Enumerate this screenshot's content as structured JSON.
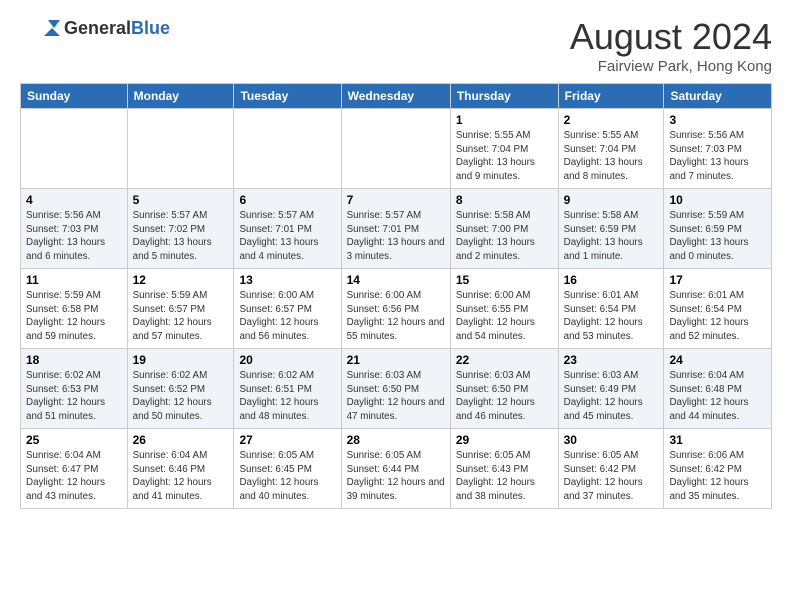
{
  "header": {
    "logo_general": "General",
    "logo_blue": "Blue",
    "month_title": "August 2024",
    "location": "Fairview Park, Hong Kong"
  },
  "days_of_week": [
    "Sunday",
    "Monday",
    "Tuesday",
    "Wednesday",
    "Thursday",
    "Friday",
    "Saturday"
  ],
  "weeks": [
    [
      {
        "num": "",
        "sunrise": "",
        "sunset": "",
        "daylight": ""
      },
      {
        "num": "",
        "sunrise": "",
        "sunset": "",
        "daylight": ""
      },
      {
        "num": "",
        "sunrise": "",
        "sunset": "",
        "daylight": ""
      },
      {
        "num": "",
        "sunrise": "",
        "sunset": "",
        "daylight": ""
      },
      {
        "num": "1",
        "sunrise": "5:55 AM",
        "sunset": "7:04 PM",
        "daylight": "13 hours and 9 minutes."
      },
      {
        "num": "2",
        "sunrise": "5:55 AM",
        "sunset": "7:04 PM",
        "daylight": "13 hours and 8 minutes."
      },
      {
        "num": "3",
        "sunrise": "5:56 AM",
        "sunset": "7:03 PM",
        "daylight": "13 hours and 7 minutes."
      }
    ],
    [
      {
        "num": "4",
        "sunrise": "5:56 AM",
        "sunset": "7:03 PM",
        "daylight": "13 hours and 6 minutes."
      },
      {
        "num": "5",
        "sunrise": "5:57 AM",
        "sunset": "7:02 PM",
        "daylight": "13 hours and 5 minutes."
      },
      {
        "num": "6",
        "sunrise": "5:57 AM",
        "sunset": "7:01 PM",
        "daylight": "13 hours and 4 minutes."
      },
      {
        "num": "7",
        "sunrise": "5:57 AM",
        "sunset": "7:01 PM",
        "daylight": "13 hours and 3 minutes."
      },
      {
        "num": "8",
        "sunrise": "5:58 AM",
        "sunset": "7:00 PM",
        "daylight": "13 hours and 2 minutes."
      },
      {
        "num": "9",
        "sunrise": "5:58 AM",
        "sunset": "6:59 PM",
        "daylight": "13 hours and 1 minute."
      },
      {
        "num": "10",
        "sunrise": "5:59 AM",
        "sunset": "6:59 PM",
        "daylight": "13 hours and 0 minutes."
      }
    ],
    [
      {
        "num": "11",
        "sunrise": "5:59 AM",
        "sunset": "6:58 PM",
        "daylight": "12 hours and 59 minutes."
      },
      {
        "num": "12",
        "sunrise": "5:59 AM",
        "sunset": "6:57 PM",
        "daylight": "12 hours and 57 minutes."
      },
      {
        "num": "13",
        "sunrise": "6:00 AM",
        "sunset": "6:57 PM",
        "daylight": "12 hours and 56 minutes."
      },
      {
        "num": "14",
        "sunrise": "6:00 AM",
        "sunset": "6:56 PM",
        "daylight": "12 hours and 55 minutes."
      },
      {
        "num": "15",
        "sunrise": "6:00 AM",
        "sunset": "6:55 PM",
        "daylight": "12 hours and 54 minutes."
      },
      {
        "num": "16",
        "sunrise": "6:01 AM",
        "sunset": "6:54 PM",
        "daylight": "12 hours and 53 minutes."
      },
      {
        "num": "17",
        "sunrise": "6:01 AM",
        "sunset": "6:54 PM",
        "daylight": "12 hours and 52 minutes."
      }
    ],
    [
      {
        "num": "18",
        "sunrise": "6:02 AM",
        "sunset": "6:53 PM",
        "daylight": "12 hours and 51 minutes."
      },
      {
        "num": "19",
        "sunrise": "6:02 AM",
        "sunset": "6:52 PM",
        "daylight": "12 hours and 50 minutes."
      },
      {
        "num": "20",
        "sunrise": "6:02 AM",
        "sunset": "6:51 PM",
        "daylight": "12 hours and 48 minutes."
      },
      {
        "num": "21",
        "sunrise": "6:03 AM",
        "sunset": "6:50 PM",
        "daylight": "12 hours and 47 minutes."
      },
      {
        "num": "22",
        "sunrise": "6:03 AM",
        "sunset": "6:50 PM",
        "daylight": "12 hours and 46 minutes."
      },
      {
        "num": "23",
        "sunrise": "6:03 AM",
        "sunset": "6:49 PM",
        "daylight": "12 hours and 45 minutes."
      },
      {
        "num": "24",
        "sunrise": "6:04 AM",
        "sunset": "6:48 PM",
        "daylight": "12 hours and 44 minutes."
      }
    ],
    [
      {
        "num": "25",
        "sunrise": "6:04 AM",
        "sunset": "6:47 PM",
        "daylight": "12 hours and 43 minutes."
      },
      {
        "num": "26",
        "sunrise": "6:04 AM",
        "sunset": "6:46 PM",
        "daylight": "12 hours and 41 minutes."
      },
      {
        "num": "27",
        "sunrise": "6:05 AM",
        "sunset": "6:45 PM",
        "daylight": "12 hours and 40 minutes."
      },
      {
        "num": "28",
        "sunrise": "6:05 AM",
        "sunset": "6:44 PM",
        "daylight": "12 hours and 39 minutes."
      },
      {
        "num": "29",
        "sunrise": "6:05 AM",
        "sunset": "6:43 PM",
        "daylight": "12 hours and 38 minutes."
      },
      {
        "num": "30",
        "sunrise": "6:05 AM",
        "sunset": "6:42 PM",
        "daylight": "12 hours and 37 minutes."
      },
      {
        "num": "31",
        "sunrise": "6:06 AM",
        "sunset": "6:42 PM",
        "daylight": "12 hours and 35 minutes."
      }
    ]
  ]
}
